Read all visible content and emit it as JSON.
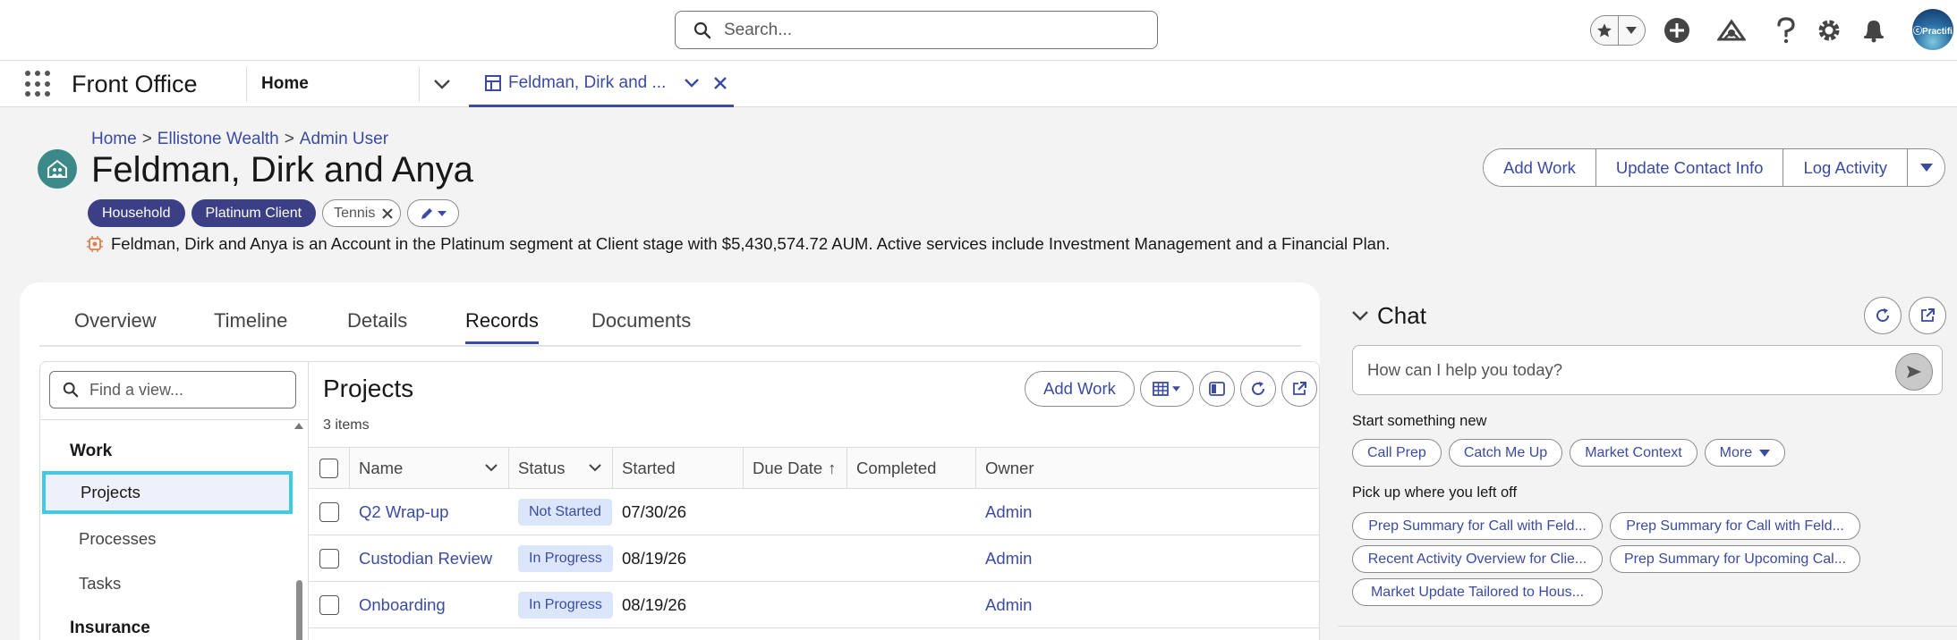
{
  "header": {
    "search_placeholder": "Search...",
    "avatar_text": "ⓒPractifi"
  },
  "navbar": {
    "app_name": "Front Office",
    "home_label": "Home",
    "record_tab_label": "Feldman, Dirk and ..."
  },
  "record": {
    "breadcrumb": [
      "Home",
      "Ellistone Wealth",
      "Admin User"
    ],
    "title": "Feldman, Dirk and Anya",
    "pills": [
      "Household",
      "Platinum Client"
    ],
    "tag": "Tennis",
    "summary": "Feldman, Dirk and Anya is an Account in the Platinum segment at Client stage with $5,430,574.72 AUM. Active services include Investment Management and a Financial Plan.",
    "actions": [
      "Add Work",
      "Update Contact Info",
      "Log Activity"
    ]
  },
  "tabs": [
    "Overview",
    "Timeline",
    "Details",
    "Records",
    "Documents"
  ],
  "records": {
    "find_placeholder": "Find a view...",
    "section_work": "Work",
    "work_items": [
      "Projects",
      "Processes",
      "Tasks"
    ],
    "section_insurance": "Insurance",
    "list_title": "Projects",
    "list_count": "3 items",
    "add_work": "Add Work",
    "columns": [
      "Name",
      "Status",
      "Started",
      "Due Date",
      "Completed",
      "Owner"
    ],
    "due_date_sort": "↑",
    "rows": [
      {
        "name": "Q2 Wrap-up",
        "status": "Not Started",
        "started": "07/30/26",
        "due": "",
        "completed": "",
        "owner": "Admin"
      },
      {
        "name": "Custodian Review",
        "status": "In Progress",
        "started": "08/19/26",
        "due": "",
        "completed": "",
        "owner": "Admin"
      },
      {
        "name": "Onboarding",
        "status": "In Progress",
        "started": "08/19/26",
        "due": "",
        "completed": "",
        "owner": "Admin"
      }
    ]
  },
  "chat": {
    "title": "Chat",
    "placeholder": "How can I help you today?",
    "start_label": "Start something new",
    "start_chips": [
      "Call Prep",
      "Catch Me Up",
      "Market Context",
      "More"
    ],
    "resume_label": "Pick up where you left off",
    "resume_chips": [
      "Prep Summary for Call with Feld...",
      "Prep Summary for Call with Feld...",
      "Recent Activity Overview for Clie...",
      "Prep Summary for Upcoming Cal...",
      "Market Update Tailored to Hous..."
    ]
  },
  "colors": {
    "brand": "#3b4ba2",
    "pill_dark": "#3b3f86",
    "record_icon": "#3c8a87",
    "selection": "#3ecbea",
    "badge_bg": "#dbe6fb"
  }
}
